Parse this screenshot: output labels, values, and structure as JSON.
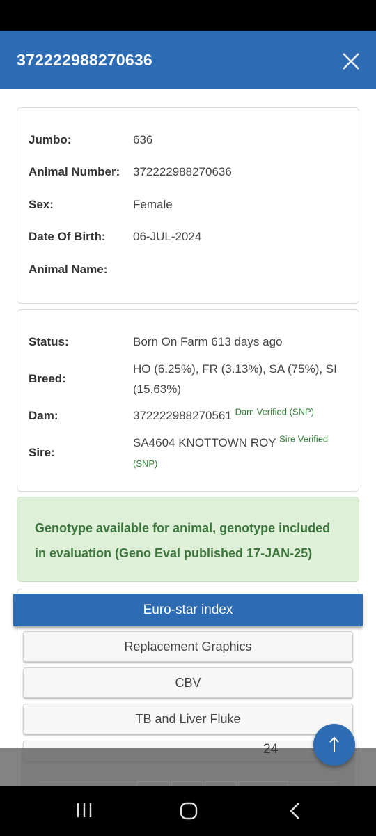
{
  "header": {
    "title": "372222988270636"
  },
  "animal": [
    {
      "label": "Jumbo:",
      "value": "636"
    },
    {
      "label": "Animal Number:",
      "value": "372222988270636"
    },
    {
      "label": "Sex:",
      "value": "Female"
    },
    {
      "label": "Date Of Birth:",
      "value": "06-JUL-2024"
    },
    {
      "label": "Animal Name:",
      "value": ""
    }
  ],
  "details": {
    "status": {
      "label": "Status:",
      "value": "Born On Farm 613 days ago"
    },
    "breed": {
      "label": "Breed:",
      "line1": "HO (6.25%), FR (3.13%), SA (75%), SI",
      "line2": "(15.63%)"
    },
    "dam": {
      "label": "Dam:",
      "value": "372222988270561",
      "verified": "Dam Verified (SNP)"
    },
    "sire": {
      "label": "Sire:",
      "value": "SA4604 KNOTTOWN ROY",
      "verified1": "Sire Verified",
      "verified2": "(SNP)"
    }
  },
  "genotype": {
    "message": "Genotype available for animal, genotype included in evaluation (Geno Eval published 17-JAN-25)"
  },
  "sections": {
    "euro_star": "Euro-star index",
    "replacement": "Replacement Graphics",
    "cbv": "CBV",
    "tb": "TB and Liver Fluke",
    "partial_value": "24"
  },
  "colors": {
    "primary": "#2d6bb3",
    "success_bg": "#dff0d8",
    "success_text": "#3c763d",
    "verified": "#2e7d32"
  },
  "icons": {
    "close": "close-icon",
    "scroll_top": "arrow-up-icon",
    "nav_recent": "recent-apps-icon",
    "nav_home": "home-icon",
    "nav_back": "back-icon"
  }
}
